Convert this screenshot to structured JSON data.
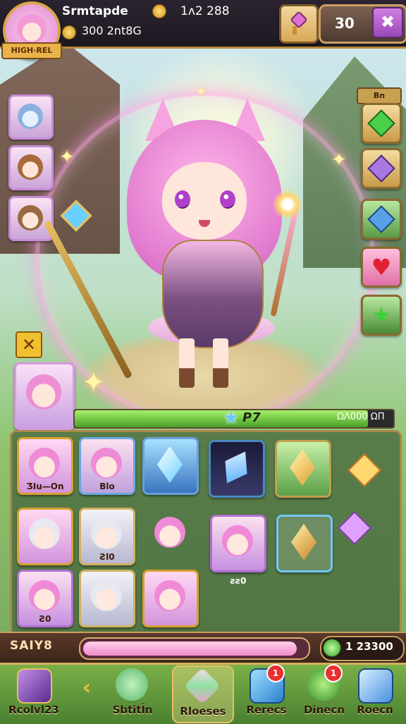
{
  "player": {
    "name": "Srmtapde",
    "coins_label": "300 2nt8G",
    "gold_amount": "1ʌ2 288",
    "level_banner": "HIGH·REL"
  },
  "top_right": {
    "counter_value": "30",
    "plus_symbol": "✖"
  },
  "skills": {
    "header": "Bn"
  },
  "hero_status": {
    "level": "P7",
    "exp_text": "ΩΛ000 ΩΠ"
  },
  "inventory": {
    "cards": [
      {
        "label": "ƷIu—On"
      },
      {
        "label": "Blo"
      },
      {
        "label": ""
      },
      {
        "label": ""
      },
      {
        "label": ""
      },
      {
        "label": ""
      },
      {
        "label": "Ƨl0"
      },
      {
        "label": ""
      },
      {
        "label": "ƨƨ0"
      },
      {
        "label": "Ƨ0"
      },
      {
        "label": ""
      },
      {
        "label": ""
      }
    ]
  },
  "status": {
    "label": "SAIY8",
    "progress_fraction": 0.96,
    "currency": "1 23300"
  },
  "hp_fraction": 0.92,
  "nav": {
    "items": [
      {
        "label": "Rcolvl23",
        "icon": "crystal-box-icon",
        "badge": ""
      },
      {
        "label": "Sbtitl̄n",
        "icon": "frog-icon",
        "badge": ""
      },
      {
        "label": "Rloeses",
        "icon": "crystal-icon",
        "badge": ""
      },
      {
        "label": "Rerecs",
        "icon": "potion-icon",
        "badge": "1"
      },
      {
        "label": "Dinecn",
        "icon": "leaf-icon",
        "badge": "1"
      },
      {
        "label": "Roecn",
        "icon": "bottle-icon",
        "badge": ""
      }
    ]
  },
  "colors": {
    "accent": "#d7a64a",
    "hero_pink": "#f09ad6",
    "nav_green": "#7ab048"
  }
}
